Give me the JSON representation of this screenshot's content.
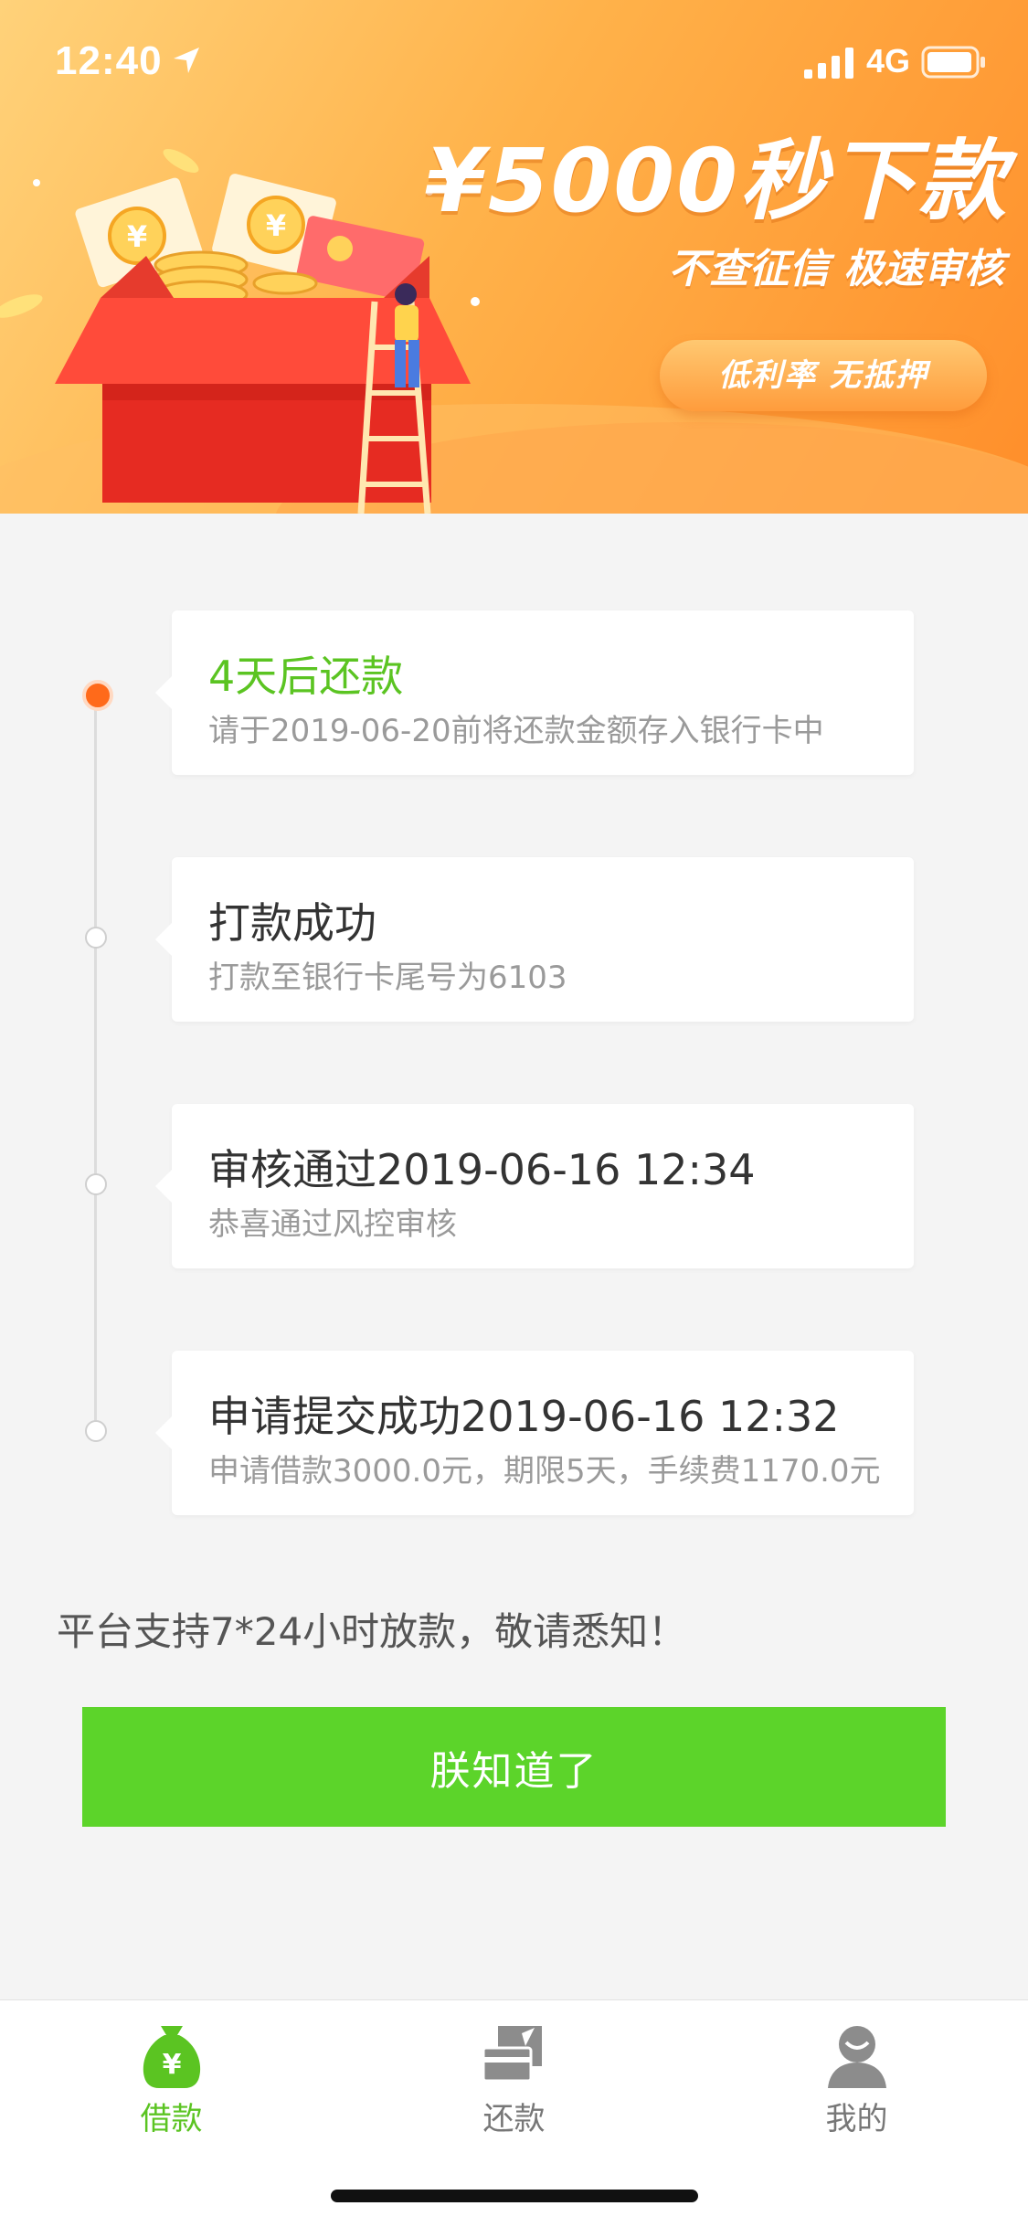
{
  "status_bar": {
    "time": "12:40",
    "network": "4G"
  },
  "banner": {
    "headline": "¥5000秒下款",
    "subline": "不查征信 极速审核",
    "pill": "低利率 无抵押"
  },
  "timeline": [
    {
      "title": "4天后还款",
      "desc": "请于2019-06-20前将还款金额存入银行卡中",
      "active": true
    },
    {
      "title": "打款成功",
      "desc": "打款至银行卡尾号为6103",
      "active": false
    },
    {
      "title": "审核通过2019-06-16 12:34",
      "desc": "恭喜通过风控审核",
      "active": false
    },
    {
      "title": "申请提交成功2019-06-16 12:32",
      "desc": "申请借款3000.0元，期限5天，手续费1170.0元",
      "active": false
    }
  ],
  "notice": "平台支持7*24小时放款，敬请悉知！",
  "cta_label": "朕知道了",
  "tabs": [
    {
      "label": "借款",
      "icon": "money-bag-icon",
      "active": true
    },
    {
      "label": "还款",
      "icon": "card-repay-icon",
      "active": false
    },
    {
      "label": "我的",
      "icon": "user-icon",
      "active": false
    }
  ],
  "colors": {
    "accent_green": "#5bc422",
    "button_green": "#5cd42a",
    "active_dot": "#ff6a1a",
    "banner_orange": "#ffa93f"
  }
}
